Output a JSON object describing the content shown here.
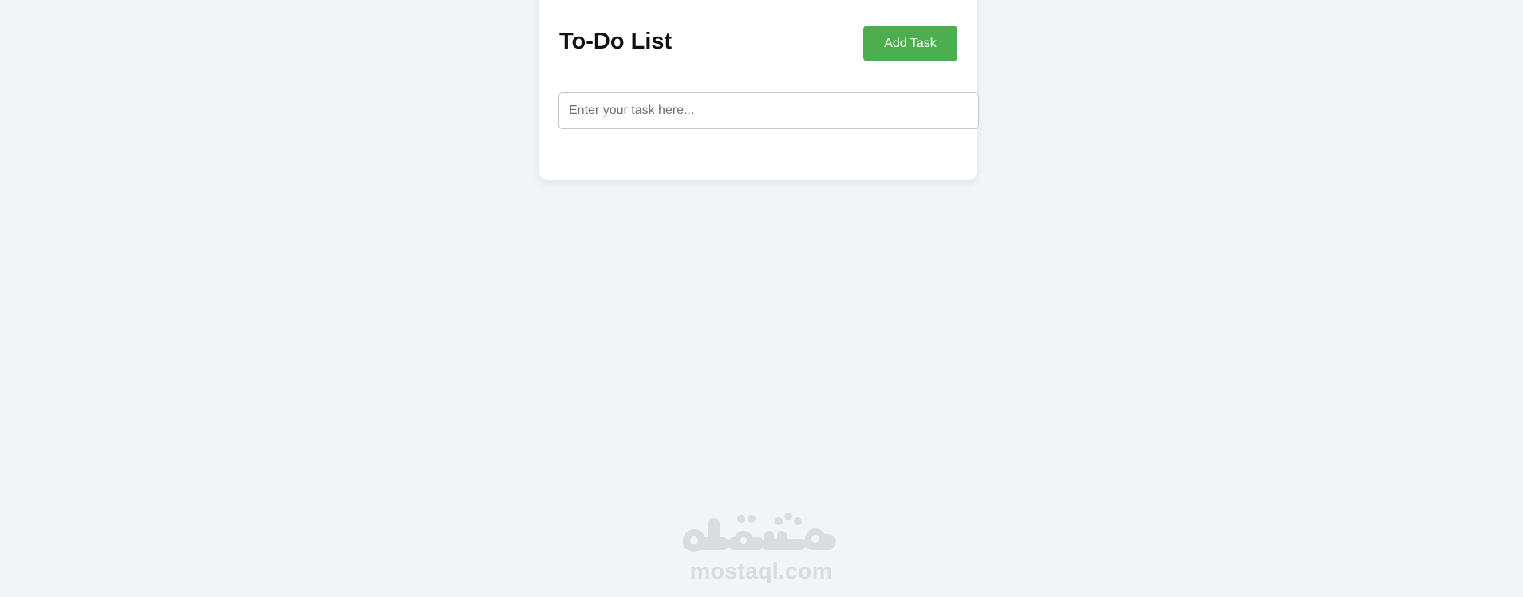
{
  "app": {
    "title": "To-Do List",
    "add_button_label": "Add Task",
    "input": {
      "placeholder": "Enter your task here...",
      "value": ""
    },
    "tasks": []
  },
  "watermark": {
    "logo_text": "مستقل",
    "domain_text": "mostaql.com"
  },
  "colors": {
    "background": "#f2f5f8",
    "card": "#ffffff",
    "accent_button": "#4cae4f",
    "watermark": "#d9dde1"
  }
}
